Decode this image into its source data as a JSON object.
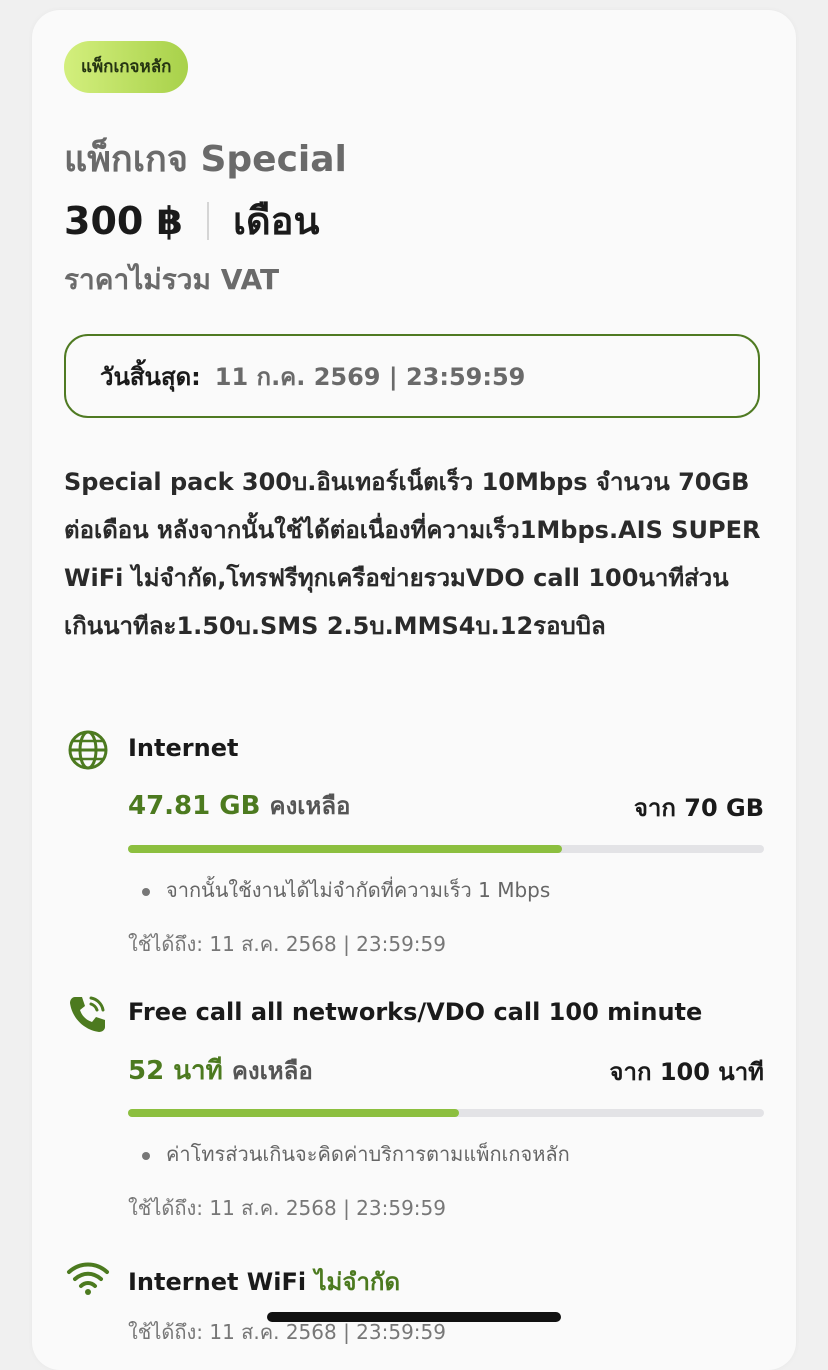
{
  "package": {
    "badge": "แพ็กเกจหลัก",
    "title": "แพ็กเกจ Special",
    "price": "300 ฿",
    "period": "เดือน",
    "vat_note": "ราคาไม่รวม VAT",
    "expiry_label": "วันสิ้นสุด:",
    "expiry_value": "11 ก.ค. 2569 | 23:59:59",
    "description": "Special pack 300บ.อินเทอร์เน็ตเร็ว 10Mbps จำนวน 70GB ต่อเดือน หลังจากนั้นใช้ได้ต่อเนื่องที่ความเร็ว1Mbps.AIS SUPER WiFi ไม่จำกัด,โทรฟรีทุกเครือข่ายรวมVDO call 100นาทีส่วนเกินนาทีละ1.50บ.SMS 2.5บ.MMS4บ.12รอบบิล"
  },
  "items": {
    "internet": {
      "icon": "globe-icon",
      "title": "Internet",
      "remaining": "47.81 GB",
      "remaining_label": "คงเหลือ",
      "total": "จาก 70 GB",
      "progress": 0.683,
      "note": "จากนั้นใช้งานได้ไม่จำกัดที่ความเร็ว 1 Mbps",
      "valid": "ใช้ได้ถึง: 11 ส.ค. 2568 | 23:59:59"
    },
    "call": {
      "icon": "phone-call-icon",
      "title": "Free call all networks/VDO call 100 minute",
      "remaining": "52 นาที",
      "remaining_label": "คงเหลือ",
      "total": "จาก 100 นาที",
      "progress": 0.52,
      "note": "ค่าโทรส่วนเกินจะคิดค่าบริการตามแพ็กเกจหลัก",
      "valid": "ใช้ได้ถึง: 11 ส.ค. 2568 | 23:59:59"
    },
    "wifi": {
      "icon": "wifi-icon",
      "title": "Internet WiFi",
      "title_extra": "ไม่จำกัด",
      "valid": "ใช้ได้ถึง: 11 ส.ค. 2568 | 23:59:59"
    }
  },
  "colors": {
    "accent": "#4c7a1f",
    "progress_fill": "#8cbf3f",
    "progress_track": "#e3e3e6"
  }
}
